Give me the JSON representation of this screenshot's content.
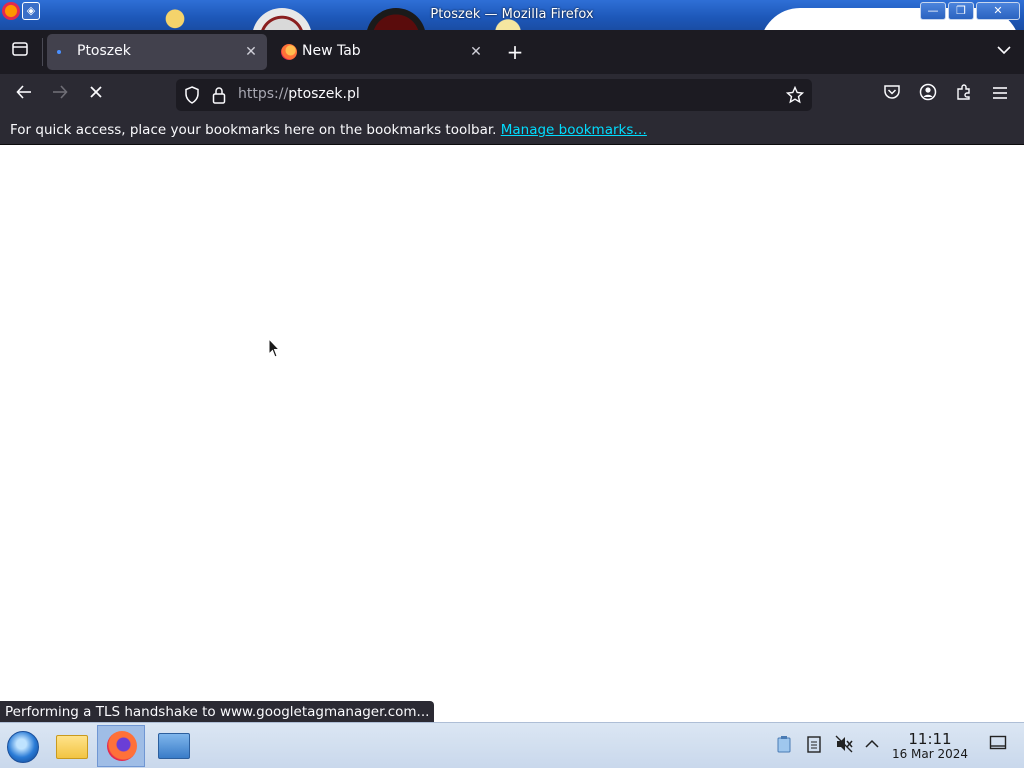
{
  "window": {
    "title": "Ptoszek — Mozilla Firefox",
    "buttons": {
      "minimize": "—",
      "maximize": "❐",
      "close": "✕"
    }
  },
  "tabs": [
    {
      "label": "Ptoszek",
      "active": true,
      "loading": true
    },
    {
      "label": "New Tab",
      "active": false,
      "icon": "firefox-icon"
    }
  ],
  "new_tab_label": "+",
  "navbar": {
    "url_scheme": "https://",
    "url_host": "ptoszek.pl"
  },
  "bookmarks_bar": {
    "message": "For quick access, place your bookmarks here on the bookmarks toolbar. ",
    "link": "Manage bookmarks…"
  },
  "status_text": "Performing a TLS handshake to www.googletagmanager.com...",
  "taskbar": {
    "clock_time": "11:11",
    "clock_date": "16 Mar 2024"
  },
  "colors": {
    "tab_strip": "#1c1b22",
    "toolbar": "#2b2a33",
    "active_tab": "#42414d",
    "link": "#00ddff",
    "taskbar": "#dbe6f3"
  }
}
